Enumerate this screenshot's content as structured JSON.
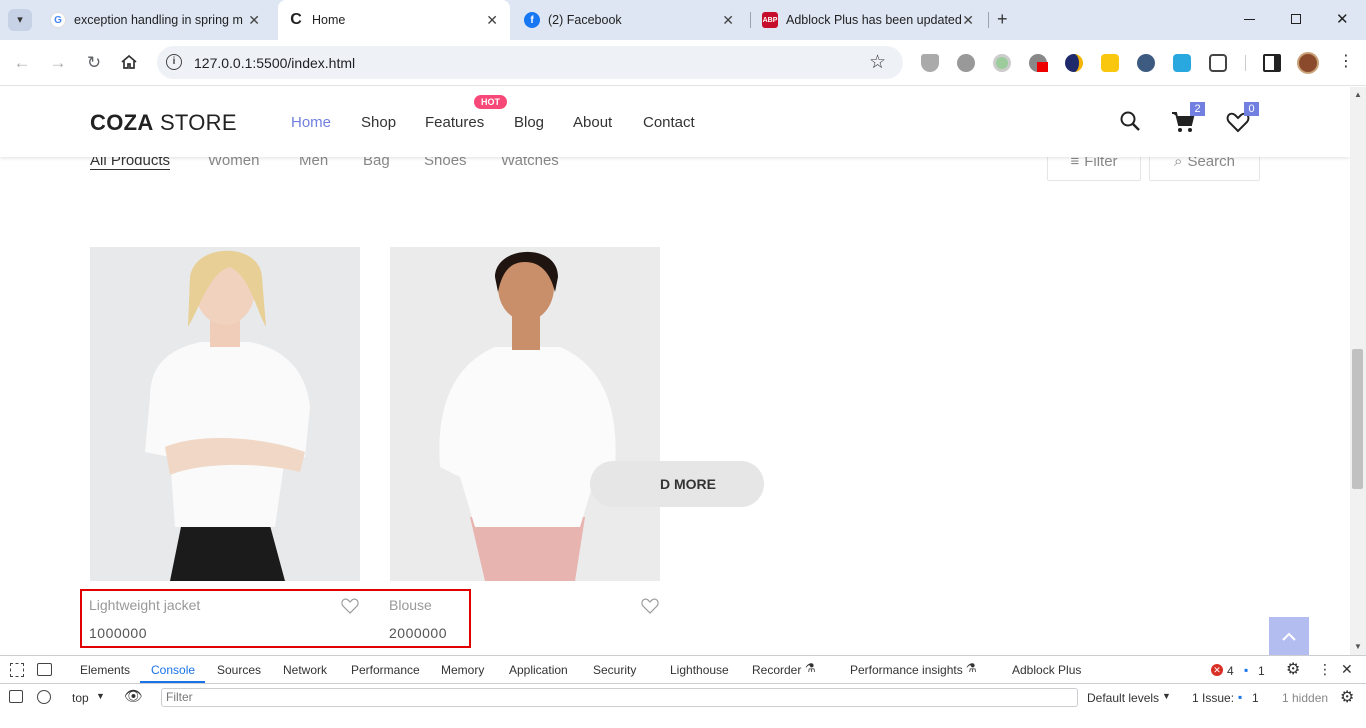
{
  "browser": {
    "tabs": [
      {
        "title": "exception handling in spring m",
        "favicon": "google-icon"
      },
      {
        "title": "Home",
        "favicon": "coza-c-icon"
      },
      {
        "title": "(2) Facebook",
        "favicon": "facebook-icon"
      },
      {
        "title": "Adblock Plus has been updated",
        "favicon": "abp-icon"
      }
    ],
    "url": "127.0.0.1:5500/index.html"
  },
  "site": {
    "logo_bold": "COZA",
    "logo_rest": " STORE",
    "menu": [
      "Home",
      "Shop",
      "Features",
      "Blog",
      "About",
      "Contact"
    ],
    "hot_badge": "HOT",
    "cart_count": "2",
    "wishlist_count": "0",
    "filters": [
      "All Products",
      "Women",
      "Men",
      "Bag",
      "Shoes",
      "Watches"
    ],
    "filter_button": "Filter",
    "search_button": "Search",
    "products": [
      {
        "name": "Lightweight jacket",
        "price": "1000000"
      },
      {
        "name": "Blouse",
        "price": "2000000"
      }
    ],
    "load_more": "D MORE"
  },
  "devtools": {
    "tabs": [
      "Elements",
      "Console",
      "Sources",
      "Network",
      "Performance",
      "Memory",
      "Application",
      "Security",
      "Lighthouse",
      "Recorder",
      "Performance insights",
      "Adblock Plus"
    ],
    "errors": "4",
    "messages": "1",
    "context": "top",
    "filter_placeholder": "Filter",
    "levels": "Default levels",
    "issues_label": "1 Issue:",
    "issues_count": "1",
    "hidden": "1 hidden"
  },
  "colors": {
    "accent": "#717fe0",
    "hot": "#f74877",
    "highlight": "#e00000"
  }
}
